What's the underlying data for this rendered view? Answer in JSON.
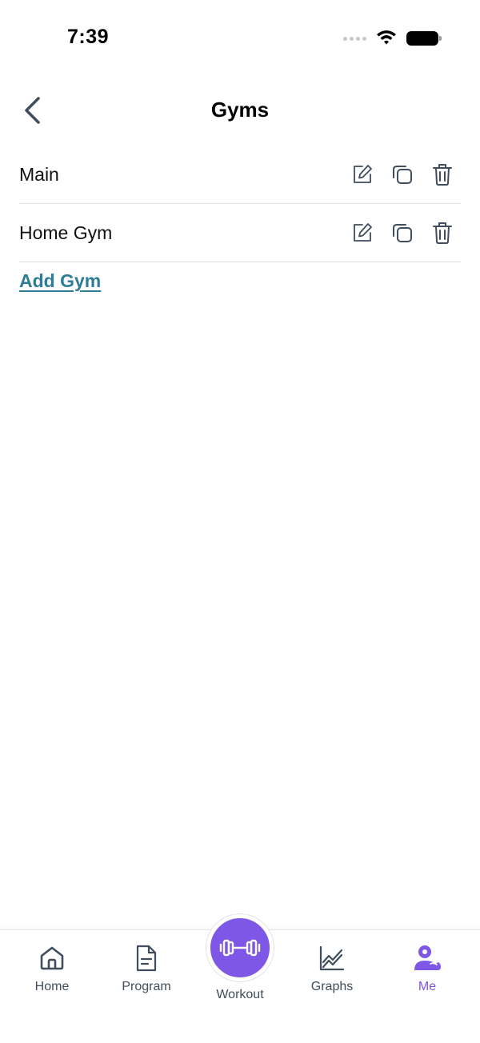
{
  "status_bar": {
    "time": "7:39"
  },
  "header": {
    "title": "Gyms"
  },
  "gyms": [
    {
      "name": "Main"
    },
    {
      "name": "Home Gym"
    }
  ],
  "add_gym_label": "Add Gym",
  "tabs": {
    "home": "Home",
    "program": "Program",
    "workout": "Workout",
    "graphs": "Graphs",
    "me": "Me",
    "active": "me"
  },
  "colors": {
    "accent": "#7e57e6",
    "link": "#2c7d95",
    "icon": "#3f4d5c"
  },
  "icons": [
    "back-arrow",
    "edit",
    "copy",
    "trash",
    "home",
    "document",
    "dumbbell",
    "line-chart",
    "user"
  ]
}
